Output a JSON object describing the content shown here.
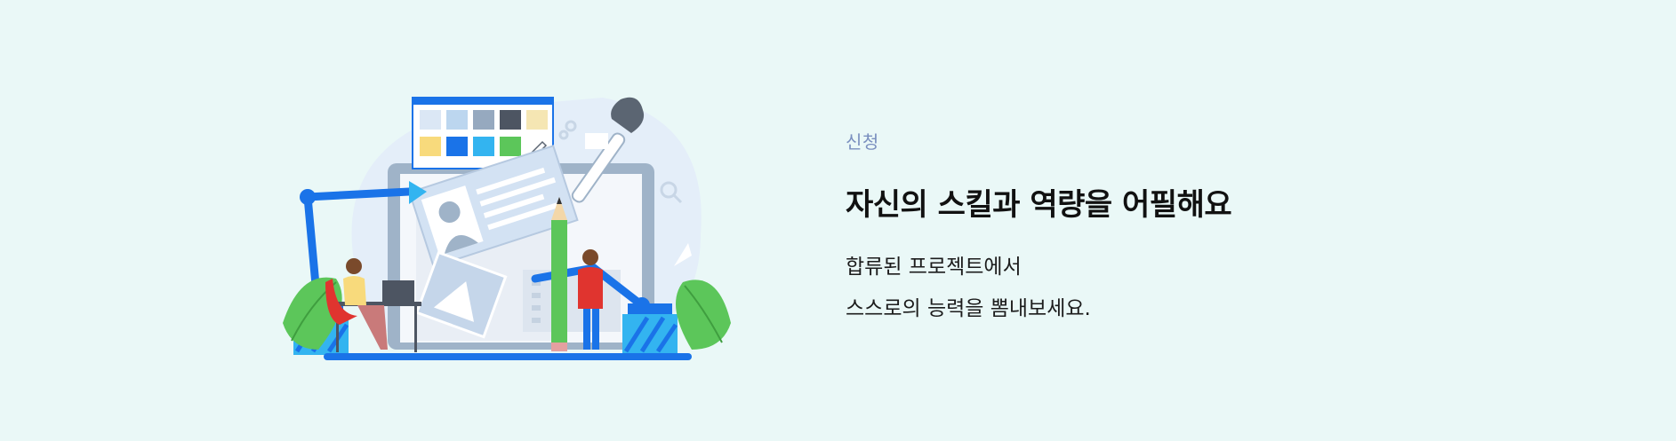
{
  "section": {
    "eyebrow": "신청",
    "headline": "자신의 스킬과 역량을 어필해요",
    "description_lines": [
      "합류된 프로젝트에서",
      "스스로의 능력을 뽐내보세요."
    ]
  },
  "illustration": {
    "subject": "designer-workspace-illustration",
    "palette": {
      "primary_blue": "#1a73e8",
      "light_blue": "#b9d4f0",
      "green": "#5cc65a",
      "red": "#e0342f",
      "gray": "#5b6572"
    }
  }
}
